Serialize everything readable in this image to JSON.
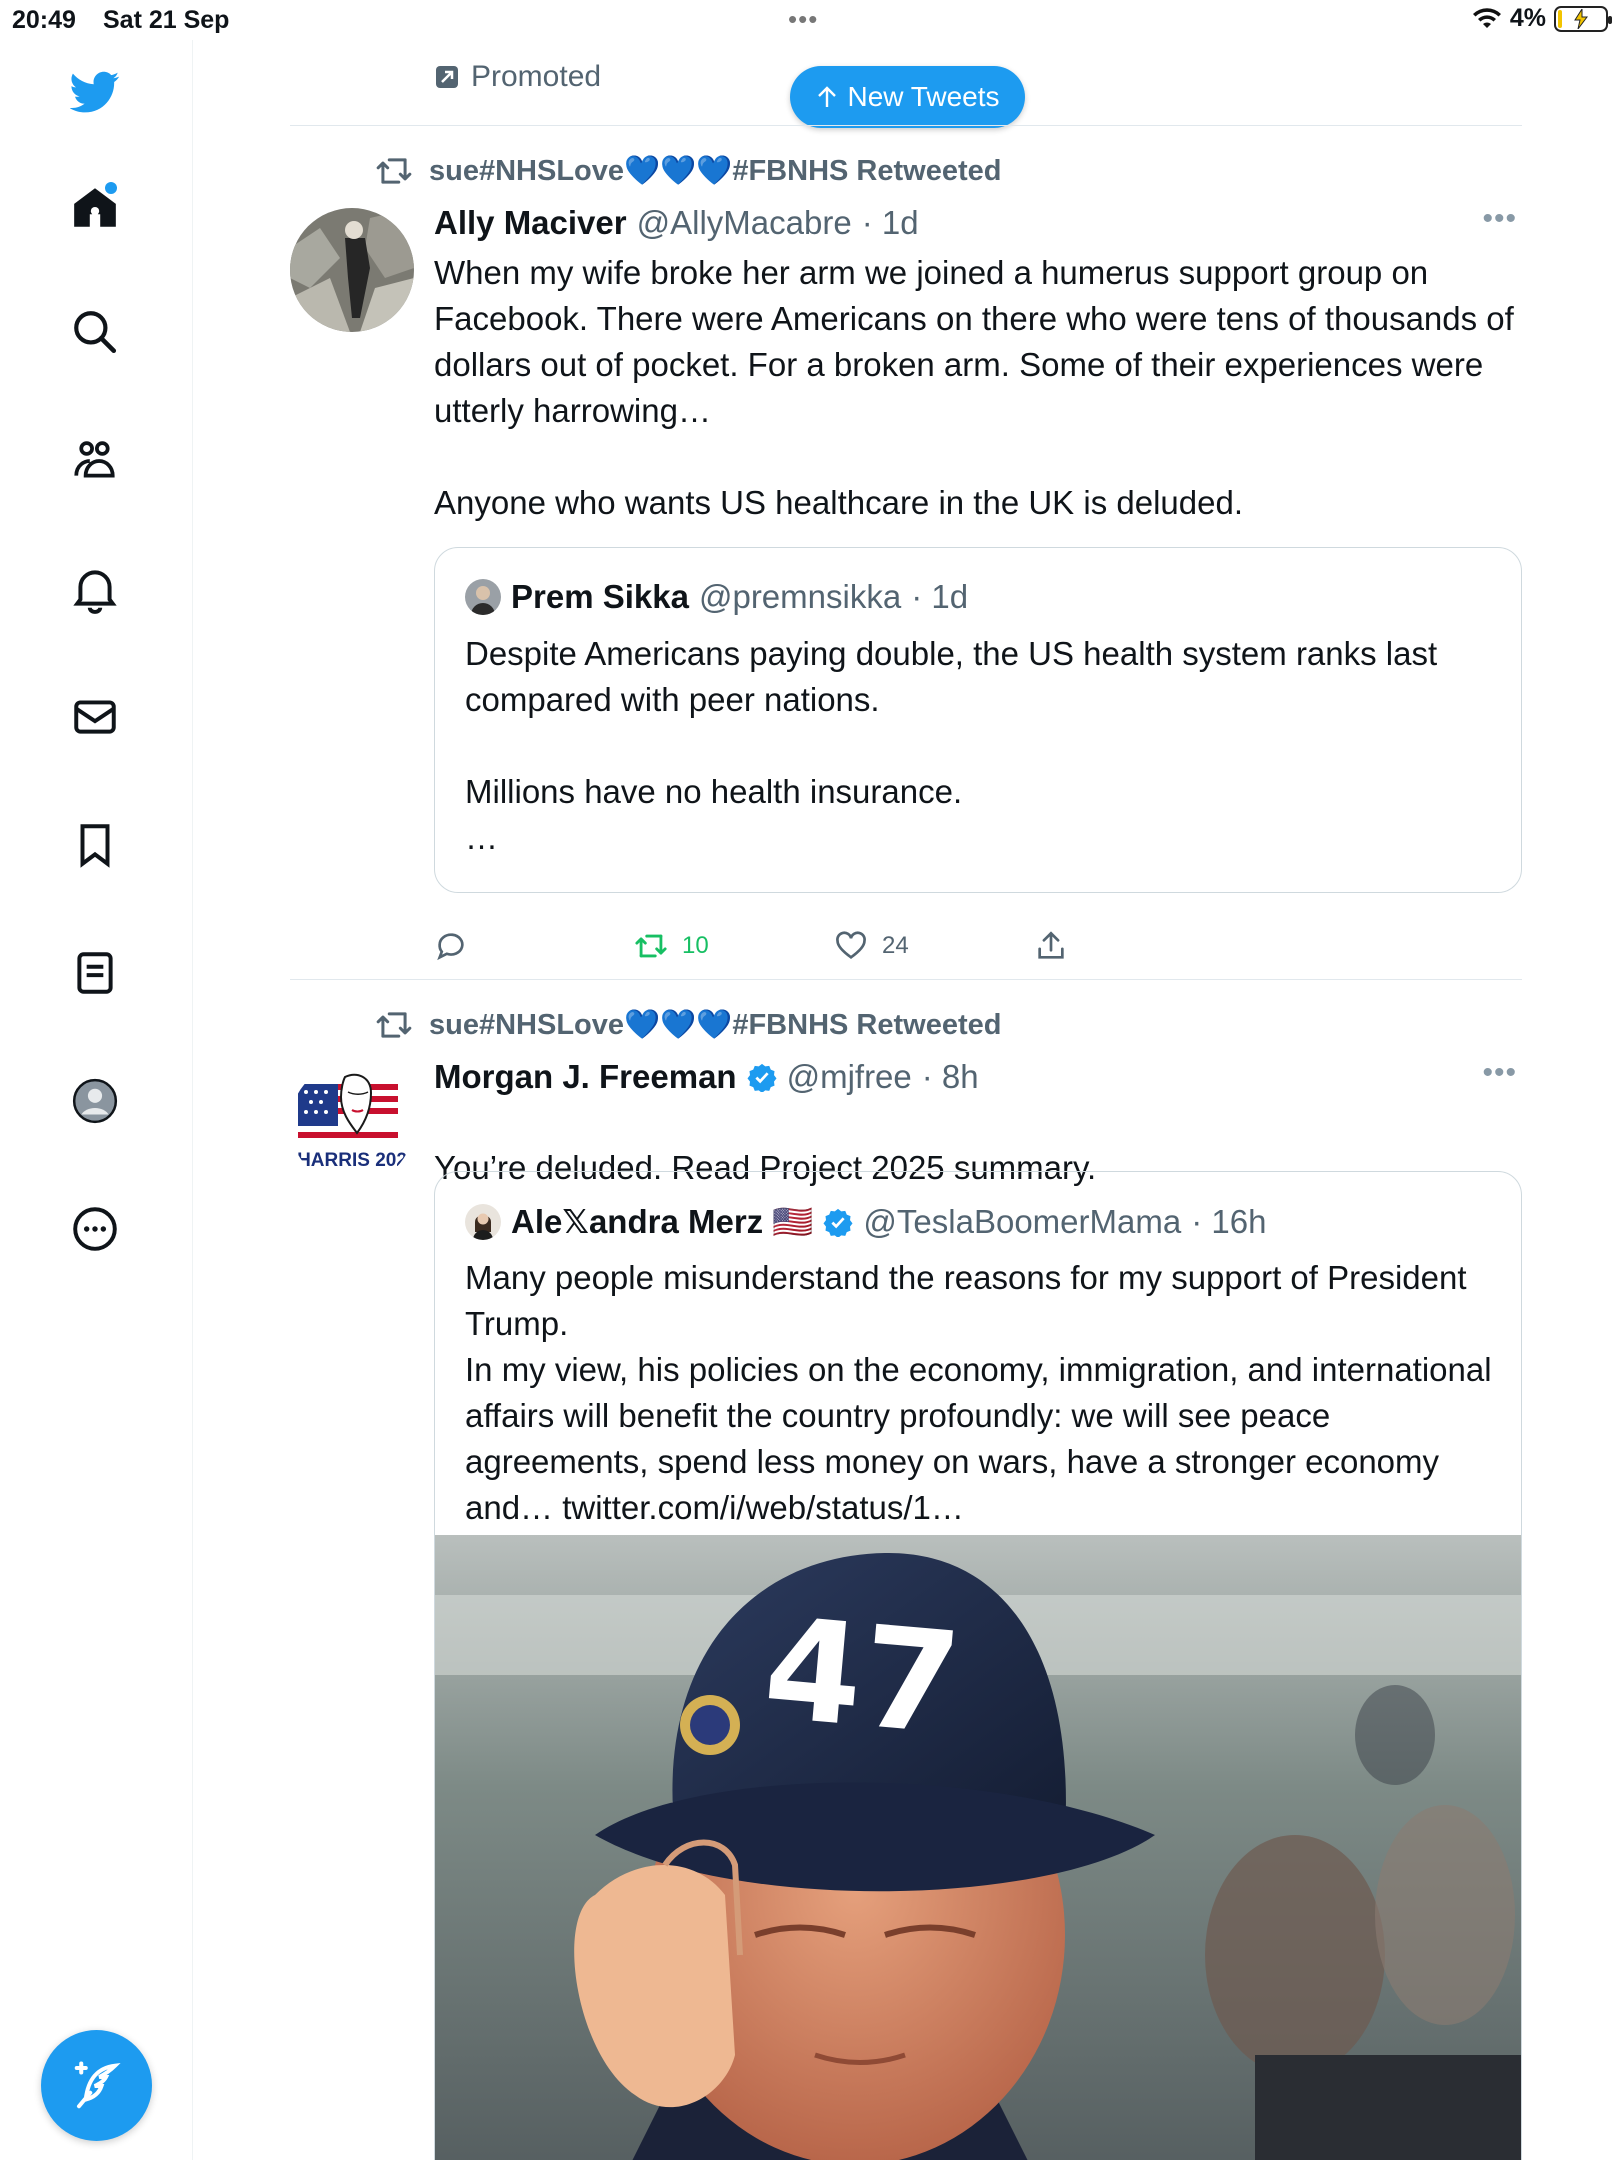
{
  "status_bar": {
    "time": "20:49",
    "date": "Sat 21 Sep",
    "battery": "4%"
  },
  "sidebar": {
    "items": [
      {
        "name": "home",
        "icon": "home-icon"
      },
      {
        "name": "explore",
        "icon": "search-icon"
      },
      {
        "name": "communities",
        "icon": "people-icon"
      },
      {
        "name": "notifications",
        "icon": "bell-icon"
      },
      {
        "name": "messages",
        "icon": "mail-icon"
      },
      {
        "name": "bookmarks",
        "icon": "bookmark-icon"
      },
      {
        "name": "lists",
        "icon": "list-icon"
      },
      {
        "name": "profile",
        "icon": "profile-icon"
      },
      {
        "name": "more",
        "icon": "more-icon"
      }
    ],
    "compose_icon": "compose-icon"
  },
  "feed": {
    "promoted_label": "Promoted",
    "new_tweets_label": "New Tweets",
    "tweets": [
      {
        "retweeted_by": "sue#NHSLove💙💙💙#FBNHS Retweeted",
        "name": "Ally Maciver",
        "handle": "@AllyMacabre",
        "time": "· 1d",
        "text": "When my wife broke her arm we joined a humerus support group on Facebook. There were Americans on there who were tens of thousands of dollars out of pocket. For a broken arm. Some of their experiences were utterly harrowing…\n\nAnyone who wants US healthcare in the UK is deluded.",
        "quote": {
          "name": "Prem Sikka",
          "handle": "@premnsikka",
          "time": "· 1d",
          "text": "Despite Americans paying double, the US health system ranks last compared with peer nations.\n\nMillions have no health insurance.\n…"
        },
        "actions": {
          "replies": "",
          "retweets": "10",
          "likes": "24"
        }
      },
      {
        "retweeted_by": "sue#NHSLove💙💙💙#FBNHS Retweeted",
        "name": "Morgan J. Freeman",
        "handle": "@mjfree",
        "time": "· 8h",
        "text": "You’re deluded.  Read Project 2025 summary.",
        "avatar_text": "HARRIS 202",
        "quote": {
          "name": "Ale𝕏andra Merz 🇺🇸",
          "handle": "@TeslaBoomerMama",
          "time": "· 16h",
          "text": "Many people misunderstand the reasons for my support of President Trump.\nIn my view, his policies on the economy, immigration, and international affairs will benefit the country profoundly: we will see peace agreements, spend less money on wars, have a stronger economy and… twitter.com/i/web/status/1…",
          "image_caption": "47"
        }
      }
    ]
  }
}
